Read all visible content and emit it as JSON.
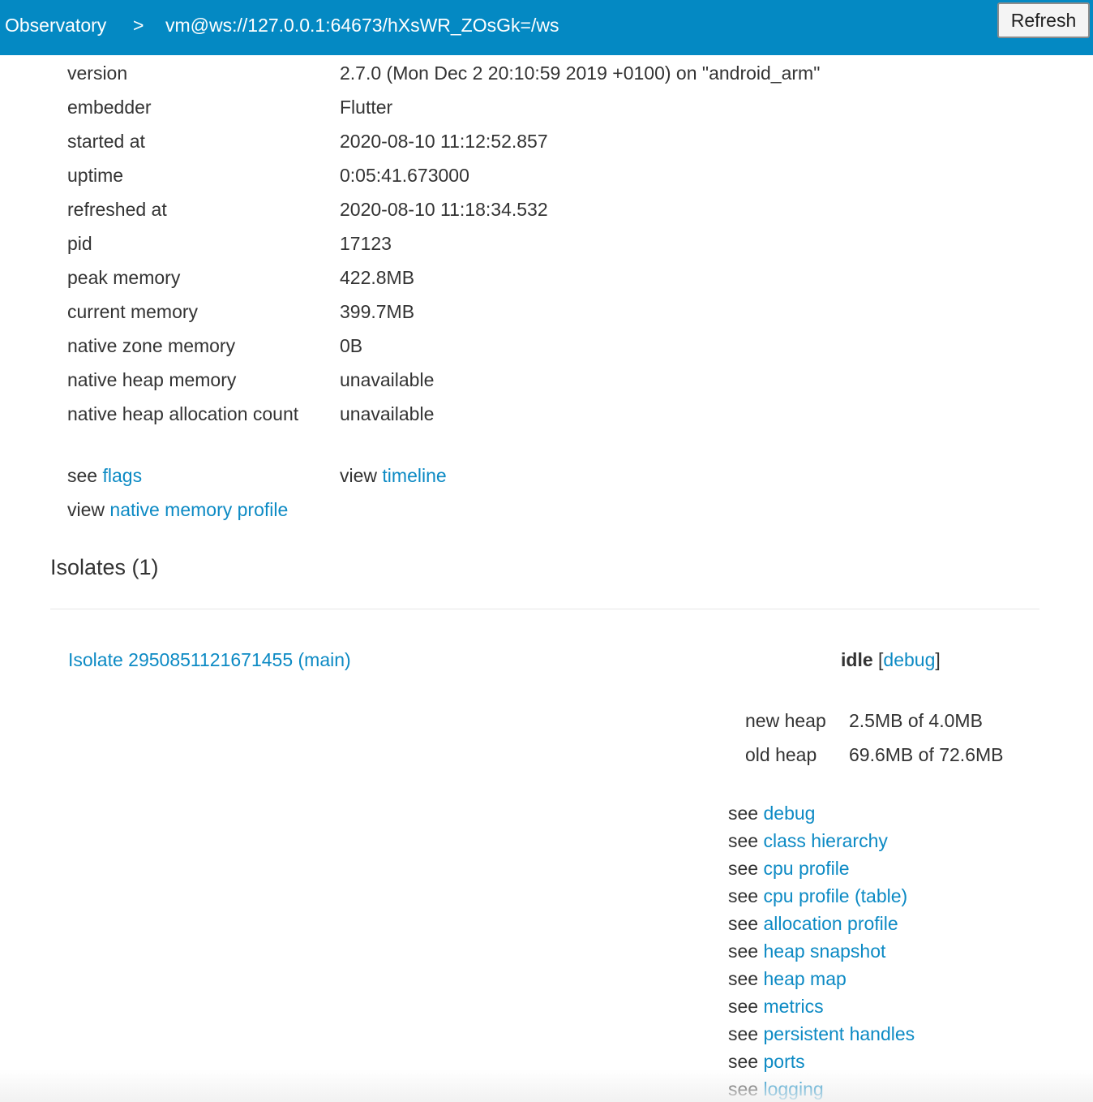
{
  "nav": {
    "root": "Observatory",
    "separator": ">",
    "target": "vm@ws://127.0.0.1:64673/hXsWR_ZOsGk=/ws",
    "refresh_label": "Refresh"
  },
  "vm_info": [
    {
      "label": "version",
      "value": "2.7.0 (Mon Dec 2 20:10:59 2019 +0100) on \"android_arm\""
    },
    {
      "label": "embedder",
      "value": "Flutter"
    },
    {
      "label": "started at",
      "value": "2020-08-10 11:12:52.857"
    },
    {
      "label": "uptime",
      "value": "0:05:41.673000"
    },
    {
      "label": "refreshed at",
      "value": "2020-08-10 11:18:34.532"
    },
    {
      "label": "pid",
      "value": "17123"
    },
    {
      "label": "peak memory",
      "value": "422.8MB"
    },
    {
      "label": "current memory",
      "value": "399.7MB"
    },
    {
      "label": "native zone memory",
      "value": "0B"
    },
    {
      "label": "native heap memory",
      "value": "unavailable"
    },
    {
      "label": "native heap allocation count",
      "value": "unavailable"
    }
  ],
  "vm_links": {
    "flags_prefix": "see",
    "flags": "flags",
    "timeline_prefix": "view",
    "timeline": "timeline",
    "native_prefix": "view",
    "native": "native memory profile"
  },
  "isolates": {
    "title": "Isolates (1)",
    "name": "Isolate 2950851121671455 (main)",
    "state": "idle",
    "open_bracket": "[",
    "debug_link": "debug",
    "close_bracket": "]",
    "heap": [
      {
        "label": "new heap",
        "value": "2.5MB of 4.0MB"
      },
      {
        "label": "old heap",
        "value": "69.6MB of 72.6MB"
      }
    ],
    "see_prefix": "see",
    "links": [
      "debug",
      "class hierarchy",
      "cpu profile",
      "cpu profile (table)",
      "allocation profile",
      "heap snapshot",
      "heap map",
      "metrics",
      "persistent handles",
      "ports",
      "logging"
    ]
  },
  "colors": {
    "nav_bg": "#0489c3",
    "link": "#0c8ac4",
    "text": "#333333"
  }
}
